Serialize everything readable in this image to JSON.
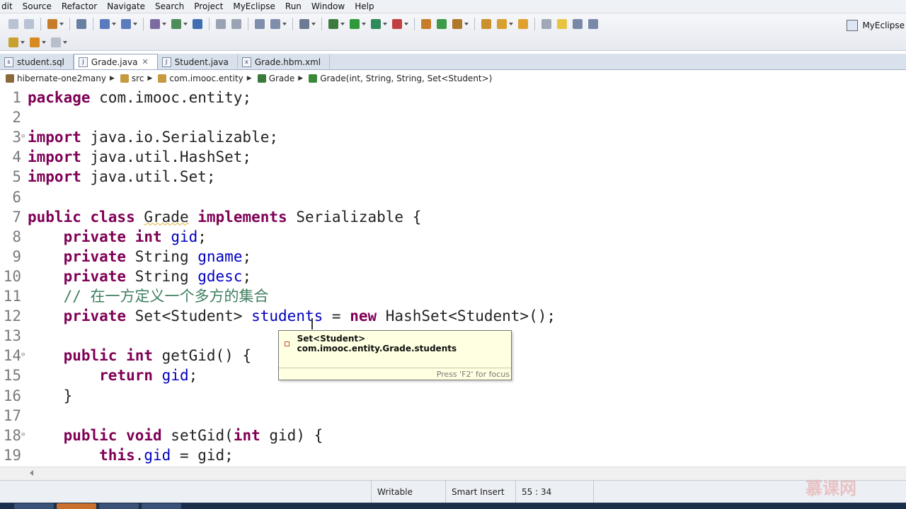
{
  "menu": [
    "dit",
    "Source",
    "Refactor",
    "Navigate",
    "Search",
    "Project",
    "MyEclipse",
    "Run",
    "Window",
    "Help"
  ],
  "toolbar": {
    "perspective_label": "MyEclipse"
  },
  "tabs": [
    {
      "label": "student.sql",
      "icon": "sql-file-icon",
      "active": false
    },
    {
      "label": "Grade.java",
      "icon": "java-file-icon",
      "active": true,
      "close": "✕"
    },
    {
      "label": "Student.java",
      "icon": "java-file-icon",
      "active": false
    },
    {
      "label": "Grade.hbm.xml",
      "icon": "xml-file-icon",
      "active": false
    }
  ],
  "breadcrumb": [
    "hibernate-one2many",
    "src",
    "com.imooc.entity",
    "Grade",
    "Grade(int, String, String, Set<Student>)"
  ],
  "editor": {
    "lines": [
      {
        "n": "1",
        "code": [
          {
            "t": "package",
            "c": "kw"
          },
          {
            "t": " com.imooc.entity;",
            "c": ""
          }
        ]
      },
      {
        "n": "2",
        "code": []
      },
      {
        "n": "3",
        "fold": "⊖",
        "code": [
          {
            "t": "import",
            "c": "kw"
          },
          {
            "t": " java.io.Serializable;",
            "c": ""
          }
        ]
      },
      {
        "n": "4",
        "code": [
          {
            "t": "import",
            "c": "kw"
          },
          {
            "t": " java.util.HashSet;",
            "c": ""
          }
        ]
      },
      {
        "n": "5",
        "code": [
          {
            "t": "import",
            "c": "kw"
          },
          {
            "t": " java.util.Set;",
            "c": ""
          }
        ]
      },
      {
        "n": "6",
        "code": []
      },
      {
        "n": "7",
        "code": [
          {
            "t": "public class",
            "c": "kw"
          },
          {
            "t": " ",
            "c": ""
          },
          {
            "t": "Grade",
            "c": "ul"
          },
          {
            "t": " ",
            "c": ""
          },
          {
            "t": "implements",
            "c": "kw"
          },
          {
            "t": " Serializable {",
            "c": ""
          }
        ]
      },
      {
        "n": "8",
        "code": [
          {
            "t": "    ",
            "c": ""
          },
          {
            "t": "private int",
            "c": "kw"
          },
          {
            "t": " ",
            "c": ""
          },
          {
            "t": "gid",
            "c": "fld"
          },
          {
            "t": ";",
            "c": ""
          }
        ]
      },
      {
        "n": "9",
        "code": [
          {
            "t": "    ",
            "c": ""
          },
          {
            "t": "private",
            "c": "kw"
          },
          {
            "t": " String ",
            "c": ""
          },
          {
            "t": "gname",
            "c": "fld"
          },
          {
            "t": ";",
            "c": ""
          }
        ]
      },
      {
        "n": "10",
        "code": [
          {
            "t": "    ",
            "c": ""
          },
          {
            "t": "private",
            "c": "kw"
          },
          {
            "t": " String ",
            "c": ""
          },
          {
            "t": "gdesc",
            "c": "fld"
          },
          {
            "t": ";",
            "c": ""
          }
        ]
      },
      {
        "n": "11",
        "code": [
          {
            "t": "    ",
            "c": ""
          },
          {
            "t": "// 在一方定义一个多方的集合",
            "c": "cmt"
          }
        ]
      },
      {
        "n": "12",
        "code": [
          {
            "t": "    ",
            "c": ""
          },
          {
            "t": "private",
            "c": "kw"
          },
          {
            "t": " Set<Student> ",
            "c": ""
          },
          {
            "t": "students",
            "c": "fld"
          },
          {
            "t": " = ",
            "c": ""
          },
          {
            "t": "new",
            "c": "kw"
          },
          {
            "t": " HashSet<Student>();",
            "c": ""
          }
        ]
      },
      {
        "n": "13",
        "code": []
      },
      {
        "n": "14",
        "fold": "⊖",
        "code": [
          {
            "t": "    ",
            "c": ""
          },
          {
            "t": "public int",
            "c": "kw"
          },
          {
            "t": " getGid() {",
            "c": ""
          }
        ]
      },
      {
        "n": "15",
        "code": [
          {
            "t": "        ",
            "c": ""
          },
          {
            "t": "return",
            "c": "kw"
          },
          {
            "t": " ",
            "c": ""
          },
          {
            "t": "gid",
            "c": "fld"
          },
          {
            "t": ";",
            "c": ""
          }
        ]
      },
      {
        "n": "16",
        "code": [
          {
            "t": "    }",
            "c": ""
          }
        ]
      },
      {
        "n": "17",
        "code": []
      },
      {
        "n": "18",
        "fold": "⊖",
        "code": [
          {
            "t": "    ",
            "c": ""
          },
          {
            "t": "public void",
            "c": "kw"
          },
          {
            "t": " setGid(",
            "c": ""
          },
          {
            "t": "int",
            "c": "kw"
          },
          {
            "t": " gid) {",
            "c": ""
          }
        ]
      },
      {
        "n": "19",
        "code": [
          {
            "t": "        ",
            "c": ""
          },
          {
            "t": "this",
            "c": "kw"
          },
          {
            "t": ".",
            "c": ""
          },
          {
            "t": "gid",
            "c": "fld"
          },
          {
            "t": " = gid;",
            "c": ""
          }
        ]
      }
    ]
  },
  "hover": {
    "signature": "Set<Student> com.imooc.entity.Grade.students",
    "hint": "Press 'F2' for focus"
  },
  "status": {
    "mode": "Writable",
    "insert": "Smart Insert",
    "position": "55 : 34"
  },
  "watermark": "慕课网",
  "colors": {
    "keyword": "#7f0055",
    "field": "#0000c0",
    "comment": "#3f7f5f"
  }
}
